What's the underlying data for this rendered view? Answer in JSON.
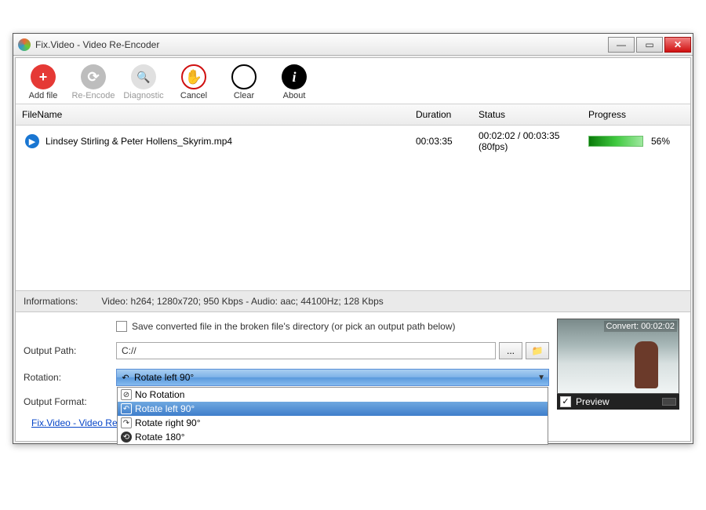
{
  "window": {
    "title": "Fix.Video - Video Re-Encoder"
  },
  "toolbar": {
    "add": "Add file",
    "reencode": "Re-Encode",
    "diagnostic": "Diagnostic",
    "cancel": "Cancel",
    "clear": "Clear",
    "about": "About"
  },
  "columns": {
    "name": "FileName",
    "duration": "Duration",
    "status": "Status",
    "progress": "Progress"
  },
  "rows": [
    {
      "filename": "Lindsey Stirling  & Peter Hollens_Skyrim.mp4",
      "duration": "00:03:35",
      "status": "00:02:02 / 00:03:35 (80fps)",
      "progress": "56%"
    }
  ],
  "info": {
    "label": "Informations:",
    "text": "Video: h264; 1280x720; 950 Kbps - Audio: aac; 44100Hz; 128 Kbps"
  },
  "settings": {
    "save_in_dir": "Save converted file in the broken file's directory (or pick an output path below)",
    "output_path_label": "Output Path:",
    "output_path_value": "C://",
    "browse_btn": "...",
    "rotation_label": "Rotation:",
    "rotation_selected": "Rotate left 90°",
    "rotation_options": [
      "No Rotation",
      "Rotate left 90°",
      "Rotate right 90°",
      "Rotate 180°"
    ],
    "output_format_label": "Output Format:"
  },
  "preview": {
    "overlay": "Convert: 00:02:02",
    "label": "Preview"
  },
  "footer": {
    "link": "Fix.Video - Video Re"
  }
}
